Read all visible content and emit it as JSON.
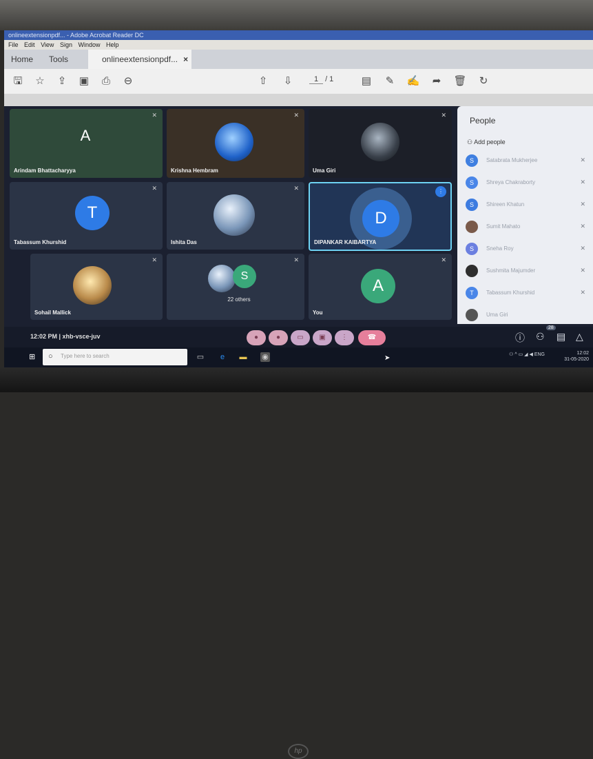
{
  "acrobat": {
    "title": "onlineextensionpdf... - Adobe Acrobat Reader DC",
    "menu": [
      "File",
      "Edit",
      "View",
      "Sign",
      "Window",
      "Help"
    ],
    "tabs": {
      "home": "Home",
      "tools": "Tools",
      "doc": "onlineextensionpdf...",
      "close": "×"
    },
    "toolbar_icons": [
      "save-icon",
      "star-icon",
      "upload-icon",
      "create-pdf-icon",
      "print-icon",
      "zoom-out-icon",
      "page-up-icon",
      "page-down-icon",
      "comment-icon",
      "pen-icon",
      "sign-icon",
      "send-icon",
      "delete-icon",
      "rotate-icon"
    ],
    "page": {
      "current": "1",
      "total": "/ 1"
    }
  },
  "meet": {
    "tiles": [
      {
        "name": "Arindam Bhattacharyya",
        "letter": "A"
      },
      {
        "name": "Krishna Hembram"
      },
      {
        "name": "Uma Giri"
      },
      {
        "name": "Tabassum Khurshid",
        "letter": "T"
      },
      {
        "name": "Ishita Das"
      },
      {
        "name": "DIPANKAR KAIBARTYA",
        "letter": "D"
      },
      {
        "name": "Sohail Mallick"
      },
      {
        "name": "22 others",
        "letter": "S"
      },
      {
        "name": "You",
        "letter": "A"
      }
    ],
    "meeting_info": "12:02 PM  |  xhb-vsce-juv",
    "people_badge": "28",
    "people": {
      "title": "People",
      "add": "Add people",
      "list": [
        {
          "initial": "S",
          "name": "Satabrata Mukherjee",
          "color": "#3f7fe0"
        },
        {
          "initial": "S",
          "name": "Shreya Chakraborty",
          "color": "#4a86e8"
        },
        {
          "initial": "S",
          "name": "Shireen Khatun",
          "color": "#3d7ce0"
        },
        {
          "initial": "",
          "name": "Sumit Mahato",
          "color": "#7a5a4a"
        },
        {
          "initial": "S",
          "name": "Sneha Roy",
          "color": "#6b7fe0"
        },
        {
          "initial": "",
          "name": "Sushmita Majumder",
          "color": "#2e2e2e"
        },
        {
          "initial": "T",
          "name": "Tabassum Khurshid",
          "color": "#4a86e8"
        },
        {
          "initial": "",
          "name": "Uma Giri",
          "color": "#555"
        }
      ]
    }
  },
  "taskbar": {
    "search_placeholder": "Type here to search",
    "time": "12:02",
    "date": "31-05-2020",
    "lang": "ENG"
  }
}
